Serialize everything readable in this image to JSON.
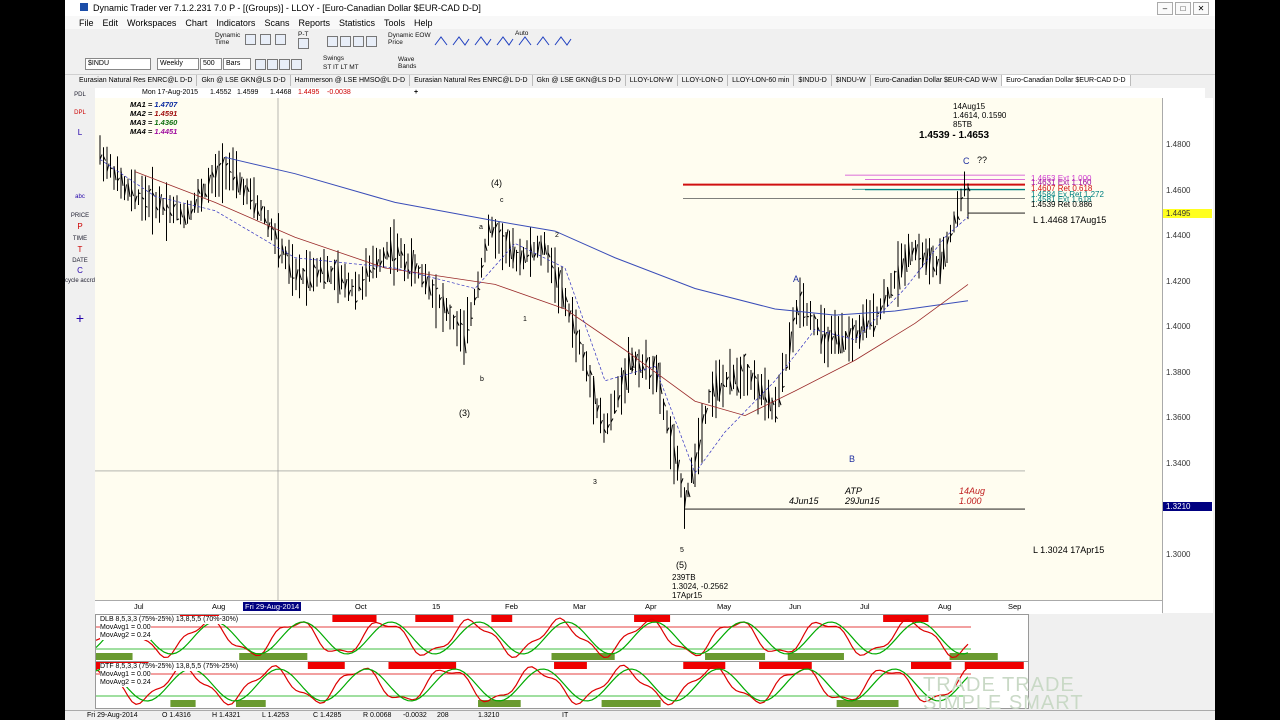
{
  "window": {
    "title": "Dynamic Trader ver 7.1.2.231 7.0 P - [(Groups)] - LLOY - [Euro-Canadian Dollar $EUR-CAD D-D]"
  },
  "menu": [
    "File",
    "Edit",
    "Workspaces",
    "Chart",
    "Indicators",
    "Scans",
    "Reports",
    "Statistics",
    "Tools",
    "Help"
  ],
  "toolbar": {
    "symbol": "$INDU",
    "period": "Weekly",
    "bars": "500",
    "bars_label": "Bars",
    "dynamic_time": "Dynamic\nTime",
    "pt": "P-T",
    "swings": "Swings",
    "swing_levels": "ST IT LT MT",
    "dynamic_price": "Dynamic EOW\nPrice",
    "auto": "Auto",
    "wave_bands": "Wave\nBands"
  },
  "tabs": [
    "Eurasian Natural Res ENRC@L D-D",
    "Gkn @ LSE GKN@LS D-D",
    "Hammerson @ LSE HMSO@L D-D",
    "Eurasian Natural Res ENRC@L D-D",
    "Gkn @ LSE GKN@LS D-D",
    "LLOY-LON-W",
    "LLOY-LON-D",
    "LLOY-LON-60 min",
    "$INDU-D",
    "$INDU-W",
    "Euro-Canadian Dollar $EUR-CAD W-W",
    "Euro-Canadian Dollar $EUR-CAD D-D"
  ],
  "header": {
    "date": "Mon 17-Aug-2015",
    "o": "1.4552",
    "h": "1.4599",
    "l": "1.4468",
    "c": "1.4495",
    "chg": "-0.0038"
  },
  "left_toolbar": [
    "PDL",
    "DPL",
    "L",
    "abc",
    "PRICE",
    "P",
    "TIME",
    "T",
    "DATE",
    "C",
    "cycle accrd"
  ],
  "ma_legend": [
    {
      "label": "MA1 =",
      "value": "1.4707",
      "color": "#0a2aa0"
    },
    {
      "label": "MA2 =",
      "value": "1.4591",
      "color": "#a01010"
    },
    {
      "label": "MA3 =",
      "value": "1.4360",
      "color": "#107010"
    },
    {
      "label": "MA4 =",
      "value": "1.4451",
      "color": "#a010a0"
    }
  ],
  "y_axis": [
    "1.4800",
    "1.4600",
    "1.4400",
    "1.4200",
    "1.4000",
    "1.3800",
    "1.3600",
    "1.3400",
    "1.3200",
    "1.3000"
  ],
  "y_current": "1.4495",
  "y_cursor": "1.3210",
  "x_axis": [
    "Jul",
    "Aug",
    "Fri 29-Aug-2014",
    "Oct",
    "15",
    "Feb",
    "Mar",
    "Apr",
    "May",
    "Jun",
    "Jul",
    "Aug",
    "Sep"
  ],
  "annotations": {
    "top_box": "14Aug15\n1.4614, 0.1590\n85TB",
    "range": "1.4539 - 1.4653",
    "wave_c": "C",
    "qq": "??",
    "w4": "(4)",
    "w3": "(3)",
    "w5": "(5)",
    "low_info": "239TB\n1.3024, -0.2562\n17Apr15",
    "low_line": "L 1.3024 17Apr15",
    "mid_line": "L 1.4468 17Aug15",
    "ret": "1.4539 Ret 0.886",
    "lines": [
      "1.4653 Ext 1.000",
      "1.4631 Ext 1.160",
      "1.4607 Ret 0.618",
      "1.4584 Ex Ret 1.272",
      "1.4581 Ext 1.618"
    ],
    "atp": "ATP",
    "d1": "4Jun15",
    "d2": "29Jun15",
    "d3": "14Aug",
    "d4": "1.000",
    "A": "A",
    "B": "B",
    "labels": [
      "a",
      "b",
      "c",
      "1",
      "2",
      "3",
      "4",
      "5"
    ]
  },
  "osc1": {
    "label": "DLB 8,5,3,3 (75%-25%) 13,8,5,5 (70%-30%)",
    "m1": "MovAvg1 = 0.00",
    "m2": "MovAvg2 = 0.24"
  },
  "osc2": {
    "label": "DTF 8,5,3,3 (75%-25%) 13,8,5,5 (75%-25%)",
    "m1": "MovAvg1 = 0.00",
    "m2": "MovAvg2 = 0.24"
  },
  "status": {
    "date": "Fri 29-Aug-2014",
    "o": "O 1.4316",
    "h": "H 1.4321",
    "l": "L 1.4253",
    "c": "C 1.4285",
    "r": "R 0.0068",
    "chg": "-0.0032",
    "n": "208",
    "price": "1.3210",
    "it": "IT"
  },
  "watermark": "TRADE TRADE\nSIMPLE SMART",
  "colors": {
    "ma1": "#3a4db8",
    "ma2": "#9a2a2a",
    "ret_line": "#d01010",
    "ext_line": "#d040d0",
    "teal_line": "#008080",
    "cursor": "#000080"
  }
}
